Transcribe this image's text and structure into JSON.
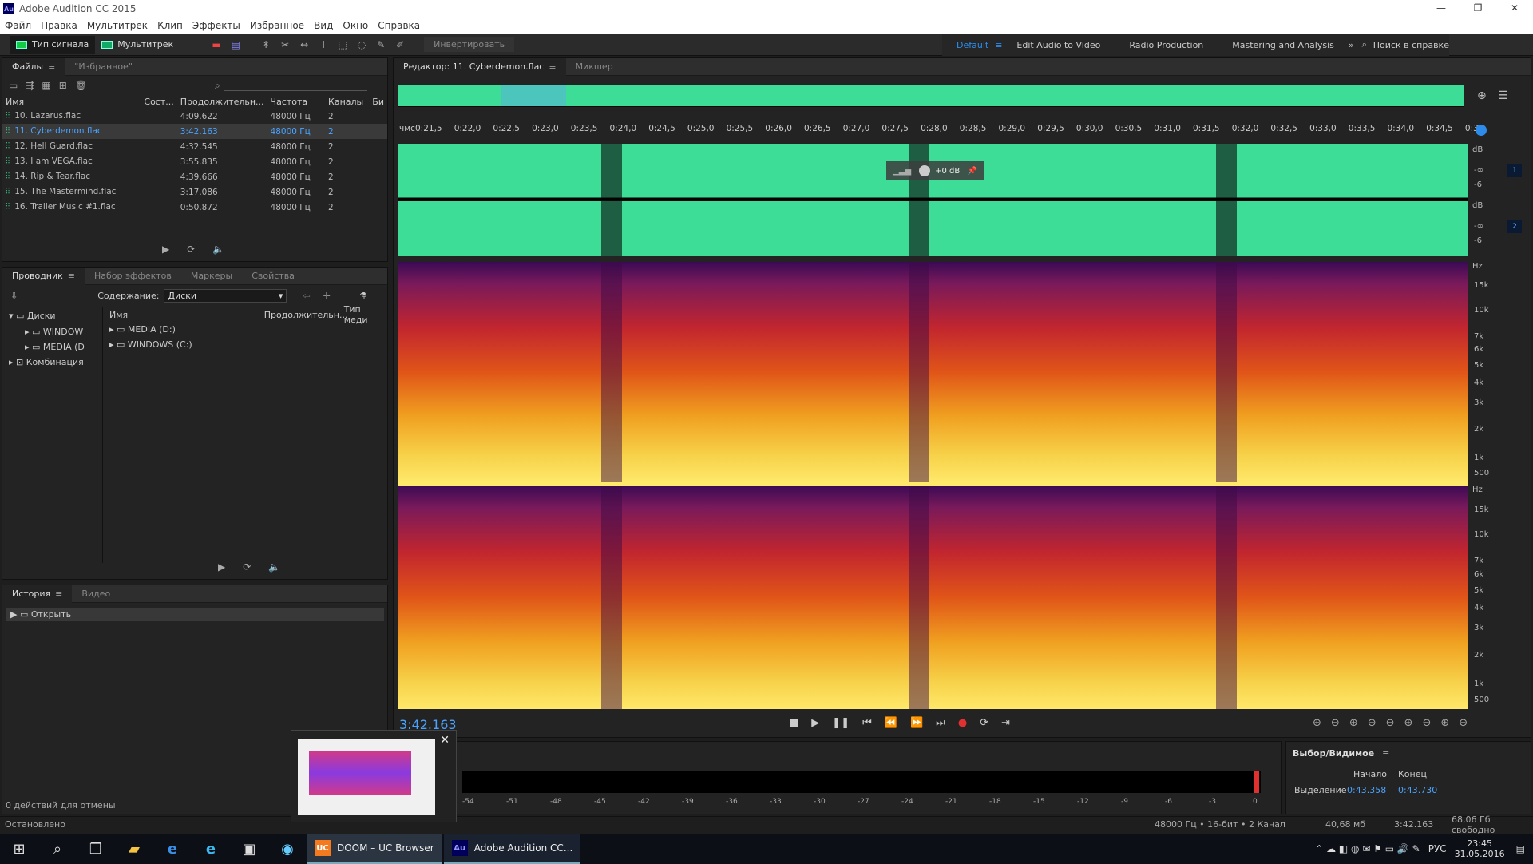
{
  "window": {
    "title": "Adobe Audition CC 2015",
    "app_icon": "Au",
    "controls": [
      "—",
      "❐",
      "✕"
    ]
  },
  "menu": [
    "Файл",
    "Правка",
    "Мультитрек",
    "Клип",
    "Эффекты",
    "Избранное",
    "Вид",
    "Окно",
    "Справка"
  ],
  "toolbar": {
    "waveform_label": "Тип сигнала",
    "multitrack_label": "Мультитрек",
    "invert_label": "Инвертировать",
    "workspaces": [
      "Default",
      "Edit Audio to Video",
      "Radio Production",
      "Mastering and Analysis"
    ],
    "search_help": "Поиск в справке"
  },
  "files_panel": {
    "tabs": [
      "Файлы",
      "\"Избранное\""
    ],
    "columns": [
      "Имя",
      "Сост...",
      "Продолжительн...",
      "Частота",
      "Каналы",
      "Би"
    ],
    "rows": [
      {
        "name": "10. Lazarus.flac",
        "duration": "4:09.622",
        "rate": "48000 Гц",
        "ch": "2"
      },
      {
        "name": "11. Cyberdemon.flac",
        "duration": "3:42.163",
        "rate": "48000 Гц",
        "ch": "2"
      },
      {
        "name": "12. Hell Guard.flac",
        "duration": "4:32.545",
        "rate": "48000 Гц",
        "ch": "2"
      },
      {
        "name": "13. I am VEGA.flac",
        "duration": "3:55.835",
        "rate": "48000 Гц",
        "ch": "2"
      },
      {
        "name": "14. Rip & Tear.flac",
        "duration": "4:39.666",
        "rate": "48000 Гц",
        "ch": "2"
      },
      {
        "name": "15. The Mastermind.flac",
        "duration": "3:17.086",
        "rate": "48000 Гц",
        "ch": "2"
      },
      {
        "name": "16. Trailer Music #1.flac",
        "duration": "0:50.872",
        "rate": "48000 Гц",
        "ch": "2"
      }
    ],
    "selected_index": 1
  },
  "explorer_panel": {
    "tabs": [
      "Проводник",
      "Набор эффектов",
      "Маркеры",
      "Свойства"
    ],
    "content_label": "Содержание:",
    "content_value": "Диски",
    "tree": [
      "Диски",
      "WINDOW",
      "MEDIA (D",
      "Комбинация"
    ],
    "columns": [
      "Имя",
      "Продолжительн...",
      "Тип меди"
    ],
    "items": [
      "MEDIA (D:)",
      "WINDOWS (C:)"
    ]
  },
  "history_panel": {
    "tabs": [
      "История",
      "Видео"
    ],
    "item": "Открыть",
    "undo_status": "0 действий для отмены"
  },
  "status": {
    "left": "Остановлено",
    "format": "48000 Гц • 16-бит • 2 Канал",
    "size": "40,68 мб",
    "duration": "3:42.163",
    "free": "68,06 Гб свободно"
  },
  "editor": {
    "tabs": [
      "Редактор: 11. Cyberdemon.flac",
      "Микшер"
    ],
    "ruler_unit": "чмс",
    "ruler": [
      "0:21,5",
      "0:22,0",
      "0:22,5",
      "0:23,0",
      "0:23,5",
      "0:24,0",
      "0:24,5",
      "0:25,0",
      "0:25,5",
      "0:26,0",
      "0:26,5",
      "0:27,0",
      "0:27,5",
      "0:28,0",
      "0:28,5",
      "0:29,0",
      "0:29,5",
      "0:30,0",
      "0:30,5",
      "0:31,0",
      "0:31,5",
      "0:32,0",
      "0:32,5",
      "0:33,0",
      "0:33,5",
      "0:34,0",
      "0:34,5",
      "0:3"
    ],
    "hud_gain": "+0 dB",
    "db_labels": [
      "dB",
      "-∞",
      "-6"
    ],
    "channel_numbers": [
      "1",
      "2"
    ],
    "hz_labels": [
      "Hz",
      "15k",
      "10k",
      "7k",
      "6k",
      "5k",
      "4k",
      "3k",
      "2k",
      "1k",
      "500"
    ],
    "time_display": "3:42.163"
  },
  "levels": {
    "scale": [
      "-54",
      "-51",
      "-48",
      "-45",
      "-42",
      "-39",
      "-36",
      "-33",
      "-30",
      "-27",
      "-24",
      "-21",
      "-18",
      "-15",
      "-12",
      "-9",
      "-6",
      "-3",
      "0"
    ]
  },
  "selection": {
    "title": "Выбор/Видимое",
    "col_start": "Начало",
    "col_end": "Конец",
    "row_label": "Выделение",
    "start": "0:43.358",
    "end": "0:43.730"
  },
  "taskbar": {
    "tasks": [
      {
        "label": "DOOM – UC Browser",
        "icon": "UC"
      },
      {
        "label": "Adobe Audition CC...",
        "icon": "Au"
      }
    ],
    "lang": "РУС",
    "time": "23:45",
    "date": "31.05.2016"
  },
  "colors": {
    "waveform": "#3ddc97",
    "accent": "#2d8ceb",
    "selected_text": "#4aa3ff",
    "record": "#e03030"
  }
}
